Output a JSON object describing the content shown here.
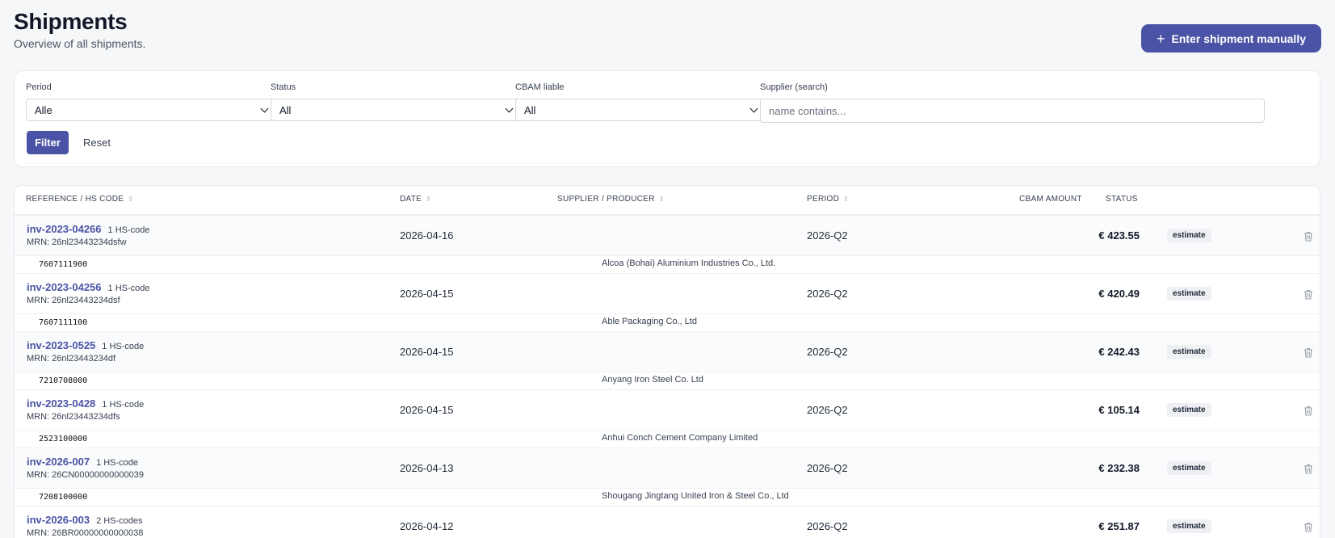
{
  "header": {
    "title": "Shipments",
    "subtitle": "Overview of all shipments.",
    "add_button_label": "Enter shipment manually"
  },
  "filters": {
    "period": {
      "label": "Period",
      "value": "Alle"
    },
    "status": {
      "label": "Status",
      "value": "All"
    },
    "cbam": {
      "label": "CBAM liable",
      "value": "All"
    },
    "supplier": {
      "label": "Supplier (search)",
      "placeholder": "name contains..."
    },
    "filter_label": "Filter",
    "reset_label": "Reset"
  },
  "table": {
    "columns": {
      "reference": "REFERENCE / HS CODE",
      "date": "DATE",
      "supplier": "SUPPLIER / PRODUCER",
      "period": "PERIOD",
      "amount": "CBAM AMOUNT",
      "status": "STATUS"
    },
    "rows": [
      {
        "ref": "inv-2023-04266",
        "hs_count": "1 HS-code",
        "mrn": "MRN: 26nl23443234dsfw",
        "date": "2026-04-16",
        "period": "2026-Q2",
        "amount": "€ 423.55",
        "status": "estimate",
        "hs_code": "7607111900",
        "supplier": "Alcoa (Bohai) Aluminium Industries Co., Ltd."
      },
      {
        "ref": "inv-2023-04256",
        "hs_count": "1 HS-code",
        "mrn": "MRN: 26nl23443234dsf",
        "date": "2026-04-15",
        "period": "2026-Q2",
        "amount": "€ 420.49",
        "status": "estimate",
        "hs_code": "7607111100",
        "supplier": "Able Packaging Co., Ltd"
      },
      {
        "ref": "inv-2023-0525",
        "hs_count": "1 HS-code",
        "mrn": "MRN: 26nl23443234df",
        "date": "2026-04-15",
        "period": "2026-Q2",
        "amount": "€ 242.43",
        "status": "estimate",
        "hs_code": "7210708000",
        "supplier": "Anyang Iron Steel Co. Ltd"
      },
      {
        "ref": "inv-2023-0428",
        "hs_count": "1 HS-code",
        "mrn": "MRN: 26nl23443234dfs",
        "date": "2026-04-15",
        "period": "2026-Q2",
        "amount": "€ 105.14",
        "status": "estimate",
        "hs_code": "2523100000",
        "supplier": "Anhui Conch Cement Company Limited"
      },
      {
        "ref": "inv-2026-007",
        "hs_count": "1 HS-code",
        "mrn": "MRN: 26CN00000000000039",
        "date": "2026-04-13",
        "period": "2026-Q2",
        "amount": "€ 232.38",
        "status": "estimate",
        "hs_code": "7208100000",
        "supplier": "Shougang Jingtang United Iron & Steel Co., Ltd"
      },
      {
        "ref": "inv-2026-003",
        "hs_count": "2 HS-codes",
        "mrn": "MRN: 26BR00000000000038",
        "date": "2026-04-12",
        "period": "2026-Q2",
        "amount": "€ 251.87",
        "status": "estimate",
        "hs_code": "",
        "supplier": ""
      }
    ]
  },
  "colors": {
    "accent": "#4a53a6",
    "background": "#f6f7f9",
    "badge_bg": "#eef0f3"
  },
  "icons": {
    "add": "plus-icon",
    "select": "chevron-down-icon",
    "sort": "sort-icon",
    "delete": "trash-icon"
  }
}
